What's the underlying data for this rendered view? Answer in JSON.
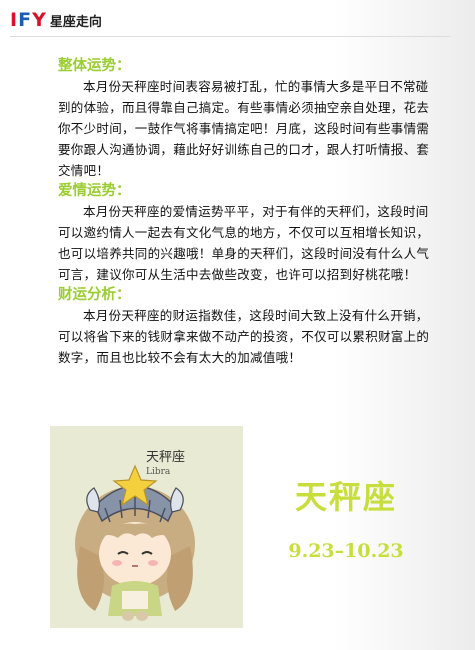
{
  "header": {
    "logo_part1": "I",
    "logo_part2": "F",
    "logo_part3": "Y",
    "site_name": "星座走向"
  },
  "sections": [
    {
      "title": "整体运势：",
      "text": "本月份天秤座时间表容易被打乱，忙的事情大多是平日不常碰到的体验，而且得靠自己搞定。有些事情必须抽空亲自处理，花去你不少时间，一鼓作气将事情搞定吧！月底，这段时间有些事情需要你跟人沟通协调，藉此好好训练自己的口才，跟人打听情报、套交情吧！"
    },
    {
      "title": "爱情运势：",
      "text": "本月份天秤座的爱情运势平平，对于有伴的天秤们，这段时间可以邀约情人一起去有文化气息的地方，不仅可以互相增长知识，也可以培养共同的兴趣哦！单身的天秤们，这段时间没有什么人气可言，建议你可从生活中去做些改变，也许可以招到好桃花哦！"
    },
    {
      "title": "财运分析：",
      "text": "本月份天秤座的财运指数佳，这段时间大致上没有什么开销，可以将省下来的钱财拿来做不动产的投资，不仅可以累积财富上的数字，而且也比较不会有太大的加减值哦！"
    }
  ],
  "card": {
    "label_cn": "天秤座",
    "label_en": "Libra"
  },
  "zodiac": {
    "name": "天秤座",
    "dates": "9.23–10.23"
  },
  "colors": {
    "accent_green": "#9acd32",
    "title_yellow_green": "#c8de3c",
    "logo_red": "#d8102a",
    "logo_blue": "#1a5fb4"
  }
}
